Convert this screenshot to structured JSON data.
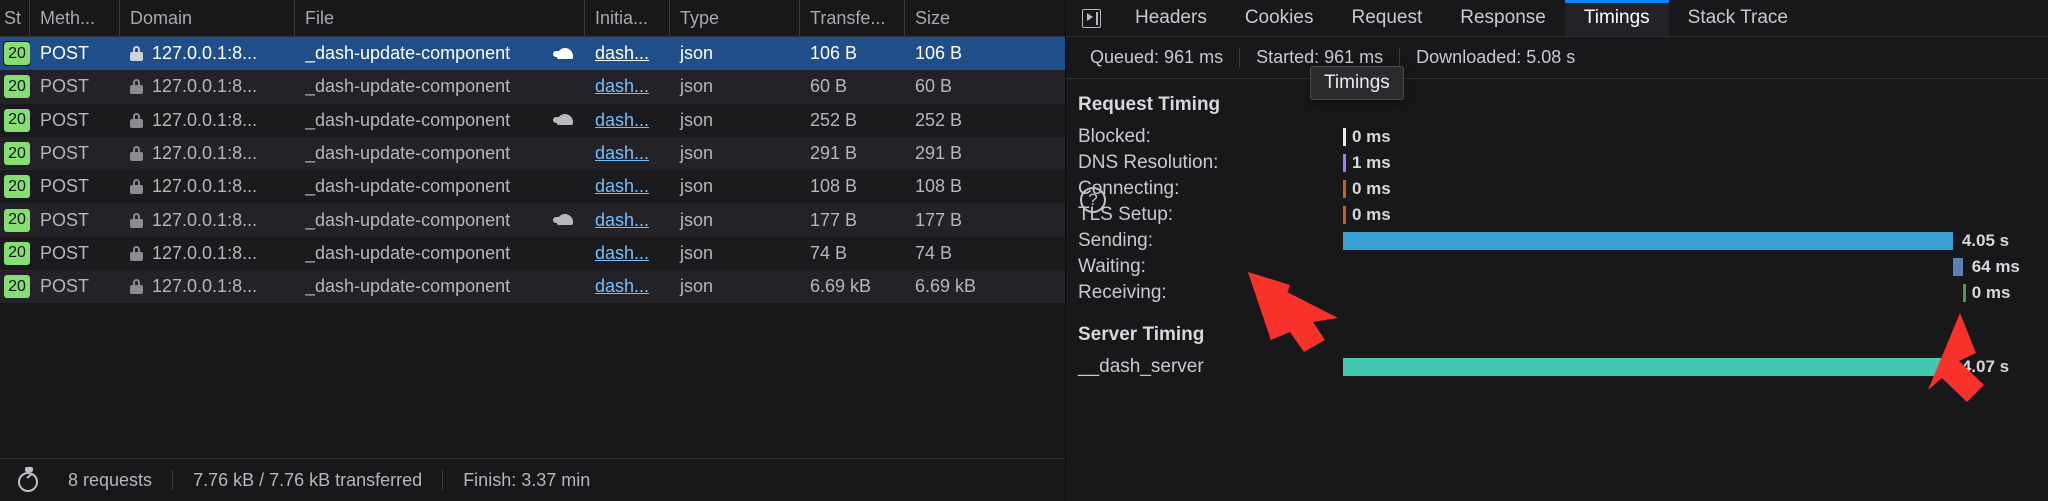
{
  "network_panel": {
    "columns": [
      {
        "key": "status",
        "label": "St"
      },
      {
        "key": "method",
        "label": "Meth..."
      },
      {
        "key": "domain",
        "label": "Domain"
      },
      {
        "key": "file",
        "label": "File"
      },
      {
        "key": "initiator",
        "label": "Initia..."
      },
      {
        "key": "type",
        "label": "Type"
      },
      {
        "key": "transferred",
        "label": "Transfe..."
      },
      {
        "key": "size",
        "label": "Size"
      }
    ],
    "rows": [
      {
        "status": "20",
        "method": "POST",
        "domain": "127.0.0.1:8...",
        "file": "_dash-update-component",
        "slow": true,
        "initiator": "dash...",
        "type": "json",
        "transferred": "106 B",
        "size": "106 B",
        "selected": true
      },
      {
        "status": "20",
        "method": "POST",
        "domain": "127.0.0.1:8...",
        "file": "_dash-update-component",
        "slow": false,
        "initiator": "dash...",
        "type": "json",
        "transferred": "60 B",
        "size": "60 B",
        "selected": false
      },
      {
        "status": "20",
        "method": "POST",
        "domain": "127.0.0.1:8...",
        "file": "_dash-update-component",
        "slow": true,
        "initiator": "dash...",
        "type": "json",
        "transferred": "252 B",
        "size": "252 B",
        "selected": false
      },
      {
        "status": "20",
        "method": "POST",
        "domain": "127.0.0.1:8...",
        "file": "_dash-update-component",
        "slow": false,
        "initiator": "dash...",
        "type": "json",
        "transferred": "291 B",
        "size": "291 B",
        "selected": false
      },
      {
        "status": "20",
        "method": "POST",
        "domain": "127.0.0.1:8...",
        "file": "_dash-update-component",
        "slow": false,
        "initiator": "dash...",
        "type": "json",
        "transferred": "108 B",
        "size": "108 B",
        "selected": false
      },
      {
        "status": "20",
        "method": "POST",
        "domain": "127.0.0.1:8...",
        "file": "_dash-update-component",
        "slow": true,
        "initiator": "dash...",
        "type": "json",
        "transferred": "177 B",
        "size": "177 B",
        "selected": false
      },
      {
        "status": "20",
        "method": "POST",
        "domain": "127.0.0.1:8...",
        "file": "_dash-update-component",
        "slow": false,
        "initiator": "dash...",
        "type": "json",
        "transferred": "74 B",
        "size": "74 B",
        "selected": false
      },
      {
        "status": "20",
        "method": "POST",
        "domain": "127.0.0.1:8...",
        "file": "_dash-update-component",
        "slow": false,
        "initiator": "dash...",
        "type": "json",
        "transferred": "6.69 kB",
        "size": "6.69 kB",
        "selected": false
      }
    ],
    "statusbar": {
      "requests": "8 requests",
      "transferred": "7.76 kB / 7.76 kB transferred",
      "finish": "Finish: 3.37 min"
    }
  },
  "details_panel": {
    "tabs": [
      {
        "label": "Headers",
        "active": false
      },
      {
        "label": "Cookies",
        "active": false
      },
      {
        "label": "Request",
        "active": false
      },
      {
        "label": "Response",
        "active": false
      },
      {
        "label": "Timings",
        "active": true
      },
      {
        "label": "Stack Trace",
        "active": false
      }
    ],
    "summary": [
      "Queued: 961 ms",
      "Started: 961 ms",
      "Downloaded: 5.08 s"
    ],
    "tooltip": "Timings",
    "request_timing": {
      "title": "Request Timing",
      "rows": [
        {
          "label": "Blocked:",
          "value": "0 ms",
          "color": "#e8e9eb",
          "left_pct": 0,
          "width_pct": 0
        },
        {
          "label": "DNS Resolution:",
          "value": "1 ms",
          "color": "#a679f6",
          "left_pct": 0,
          "width_pct": 0
        },
        {
          "label": "Connecting:",
          "value": "0 ms",
          "color": "#c4641a",
          "left_pct": 0,
          "width_pct": 0
        },
        {
          "label": "TLS Setup:",
          "value": "0 ms",
          "color": "#c4641a",
          "left_pct": 0,
          "width_pct": 0
        },
        {
          "label": "Sending:",
          "value": "4.05 s",
          "color": "#3a9fd4",
          "left_pct": 0,
          "width_pct": 86.5
        },
        {
          "label": "Waiting:",
          "value": "64 ms",
          "color": "#5a81b5",
          "left_pct": 86.5,
          "width_pct": 1.4
        },
        {
          "label": "Receiving:",
          "value": "0 ms",
          "color": "#3fa34d",
          "left_pct": 87.9,
          "width_pct": 0
        }
      ]
    },
    "server_timing": {
      "title": "Server Timing",
      "rows": [
        {
          "label": "__dash_server",
          "value": "4.07 s",
          "color": "#45c8b0",
          "left_pct": 0,
          "width_pct": 86.5
        }
      ]
    },
    "help_label": "?"
  },
  "theme": {
    "accent": "#0a84ff",
    "selection": "#204e8a",
    "status_ok": "#86de74",
    "annotation": "#f8312b"
  }
}
